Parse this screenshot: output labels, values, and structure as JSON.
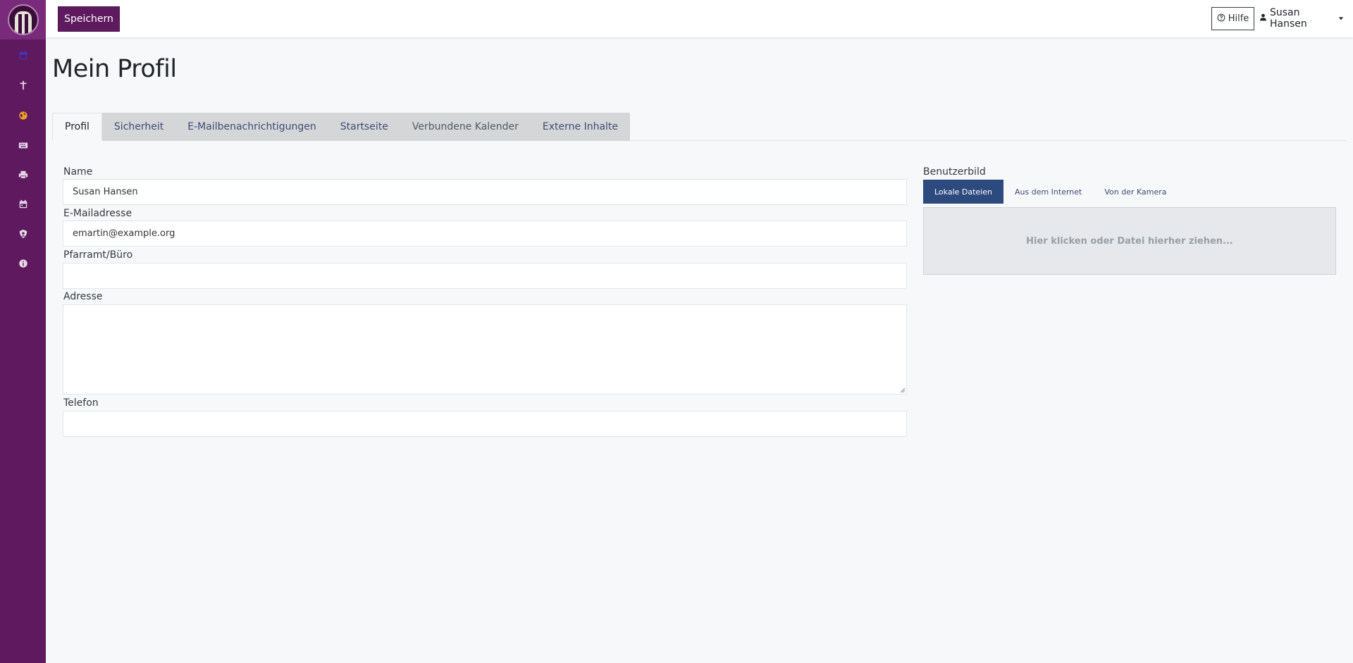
{
  "toolbar": {
    "save_label": "Speichern"
  },
  "header": {
    "help_label": "Hilfe",
    "user_name": "Susan Hansen"
  },
  "sidebar": {
    "items": [
      {
        "icon": "calendar-check-icon",
        "color": "#3b3bd6"
      },
      {
        "icon": "cross-icon",
        "color": "#e8dbe8"
      },
      {
        "icon": "globe-icon",
        "color": "#f0a020"
      },
      {
        "icon": "keyboard-icon",
        "color": "#e8dbe8"
      },
      {
        "icon": "printer-icon",
        "color": "#e8dbe8"
      },
      {
        "icon": "calendar-icon",
        "color": "#e8dbe8"
      },
      {
        "icon": "user-shield-icon",
        "color": "#e8dbe8"
      },
      {
        "icon": "info-icon",
        "color": "#e8dbe8"
      }
    ]
  },
  "page": {
    "title": "Mein Profil"
  },
  "tabs": [
    {
      "label": "Profil",
      "active": true
    },
    {
      "label": "Sicherheit"
    },
    {
      "label": "E-Mailbenachrichtigungen"
    },
    {
      "label": "Startseite"
    },
    {
      "label": "Verbundene Kalender"
    },
    {
      "label": "Externe Inhalte"
    }
  ],
  "form": {
    "name_label": "Name",
    "name_value": "Susan Hansen",
    "email_label": "E-Mailadresse",
    "email_value": "emartin@example.org",
    "office_label": "Pfarramt/Büro",
    "office_value": "",
    "address_label": "Adresse",
    "address_value": "",
    "phone_label": "Telefon",
    "phone_value": ""
  },
  "avatar": {
    "label": "Benutzerbild",
    "tabs": [
      "Lokale Dateien",
      "Aus dem Internet",
      "Von der Kamera"
    ],
    "dropzone_text": "Hier klicken oder Datei hierher ziehen..."
  },
  "colors": {
    "brand": "#5f1a5f",
    "accent_tab": "#2c4a7e"
  }
}
